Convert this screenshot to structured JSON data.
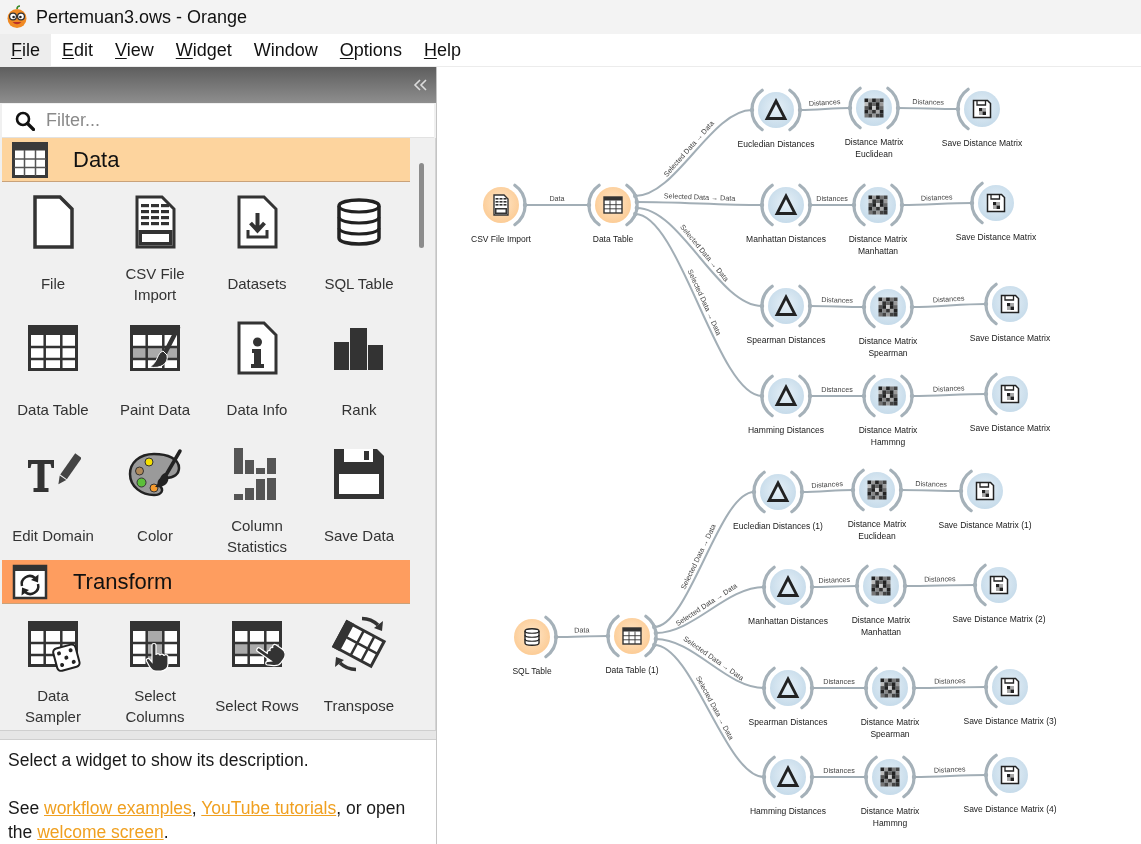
{
  "window": {
    "title": "Pertemuan3.ows - Orange"
  },
  "menu": [
    {
      "label": "File",
      "mnemonic": true,
      "selected": true
    },
    {
      "label": "Edit",
      "mnemonic": true,
      "selected": false
    },
    {
      "label": "View",
      "mnemonic": true,
      "selected": false
    },
    {
      "label": "Widget",
      "mnemonic": true,
      "selected": false
    },
    {
      "label": "Window",
      "mnemonic": false,
      "selected": false
    },
    {
      "label": "Options",
      "mnemonic": true,
      "selected": false
    },
    {
      "label": "Help",
      "mnemonic": true,
      "selected": false
    }
  ],
  "toolbox": {
    "filter": {
      "placeholder": "Filter..."
    },
    "categories": [
      {
        "name": "Data",
        "kind": "data",
        "color": "#fdd49e",
        "widgets": [
          {
            "label": "File",
            "kind": "file"
          },
          {
            "label": "CSV File Import",
            "kind": "csv"
          },
          {
            "label": "Datasets",
            "kind": "datasets"
          },
          {
            "label": "SQL Table",
            "kind": "sql"
          },
          {
            "label": "Data Table",
            "kind": "table"
          },
          {
            "label": "Paint Data",
            "kind": "paint"
          },
          {
            "label": "Data Info",
            "kind": "info"
          },
          {
            "label": "Rank",
            "kind": "rank"
          },
          {
            "label": "Edit Domain",
            "kind": "domain"
          },
          {
            "label": "Color",
            "kind": "color"
          },
          {
            "label": "Column Statistics",
            "kind": "statistics"
          },
          {
            "label": "Save Data",
            "kind": "save"
          }
        ]
      },
      {
        "name": "Transform",
        "kind": "transform",
        "color": "#fe9d5f",
        "widgets": [
          {
            "label": "Data Sampler",
            "kind": "sampler"
          },
          {
            "label": "Select Columns",
            "kind": "columns"
          },
          {
            "label": "Select Rows",
            "kind": "rows"
          },
          {
            "label": "Transpose",
            "kind": "transpose"
          }
        ]
      }
    ]
  },
  "description": {
    "text": "Select a widget to show its description.",
    "help": [
      {
        "kind": "text",
        "text": "See "
      },
      {
        "kind": "link",
        "text": "workflow examples"
      },
      {
        "kind": "text",
        "text": ", "
      },
      {
        "kind": "link",
        "text": "YouTube tutorials"
      },
      {
        "kind": "text",
        "text": ", or open the "
      },
      {
        "kind": "link",
        "text": "welcome screen"
      },
      {
        "kind": "text",
        "text": "."
      }
    ]
  },
  "canvas": {
    "workflows": [
      {
        "head": [
          {
            "title": "CSV File Import",
            "kind": "csv"
          },
          {
            "title": "Data Table",
            "kind": "table"
          }
        ],
        "head_link": "Data",
        "branches": [
          {
            "nodes": [
              {
                "title": "Eucledian Distances",
                "kind": "distances"
              },
              {
                "title": "Distance Matrix\nEuclidean",
                "kind": "matrix"
              },
              {
                "title": "Save Distance Matrix",
                "kind": "save"
              }
            ],
            "links": [
              "Selected Data → Data",
              "Distances",
              "Distances"
            ]
          },
          {
            "nodes": [
              {
                "title": "Manhattan Distances",
                "kind": "distances"
              },
              {
                "title": "Distance Matrix\nManhattan",
                "kind": "matrix"
              },
              {
                "title": "Save Distance Matrix",
                "kind": "save"
              }
            ],
            "links": [
              "Selected Data → Data",
              "Distances",
              "Distances"
            ]
          },
          {
            "nodes": [
              {
                "title": "Spearman Distances",
                "kind": "distances"
              },
              {
                "title": "Distance Matrix\nSpearman",
                "kind": "matrix"
              },
              {
                "title": "Save Distance Matrix",
                "kind": "save"
              }
            ],
            "links": [
              "Selected Data → Data",
              "Distances",
              "Distances"
            ]
          },
          {
            "nodes": [
              {
                "title": "Hamming Distances",
                "kind": "distances"
              },
              {
                "title": "Distance Matrix\nHammng",
                "kind": "matrix"
              },
              {
                "title": "Save Distance Matrix",
                "kind": "save"
              }
            ],
            "links": [
              "Selected Data → Data",
              "Distances",
              "Distances"
            ]
          }
        ]
      },
      {
        "head": [
          {
            "title": "SQL Table",
            "kind": "sql"
          },
          {
            "title": "Data Table (1)",
            "kind": "table"
          }
        ],
        "head_link": "Data",
        "branches": [
          {
            "nodes": [
              {
                "title": "Eucledian Distances (1)",
                "kind": "distances"
              },
              {
                "title": "Distance Matrix\nEuclidean",
                "kind": "matrix"
              },
              {
                "title": "Save Distance Matrix (1)",
                "kind": "save"
              }
            ],
            "links": [
              "Selected Data → Data",
              "Distances",
              "Distances"
            ]
          },
          {
            "nodes": [
              {
                "title": "Manhattan Distances",
                "kind": "distances"
              },
              {
                "title": "Distance Matrix\nManhattan",
                "kind": "matrix"
              },
              {
                "title": "Save Distance Matrix (2)",
                "kind": "save"
              }
            ],
            "links": [
              "Selected Data → Data",
              "Distances",
              "Distances"
            ]
          },
          {
            "nodes": [
              {
                "title": "Spearman Distances",
                "kind": "distances"
              },
              {
                "title": "Distance Matrix\nSpearman",
                "kind": "matrix"
              },
              {
                "title": "Save Distance Matrix (3)",
                "kind": "save"
              }
            ],
            "links": [
              "Selected Data → Data",
              "Distances",
              "Distances"
            ]
          },
          {
            "nodes": [
              {
                "title": "Hamming Distances",
                "kind": "distances"
              },
              {
                "title": "Distance Matrix\nHammng",
                "kind": "matrix"
              },
              {
                "title": "Save Distance Matrix (4)",
                "kind": "save"
              }
            ],
            "links": [
              "Selected Data → Data",
              "Distances",
              "Distances"
            ]
          }
        ]
      }
    ]
  }
}
